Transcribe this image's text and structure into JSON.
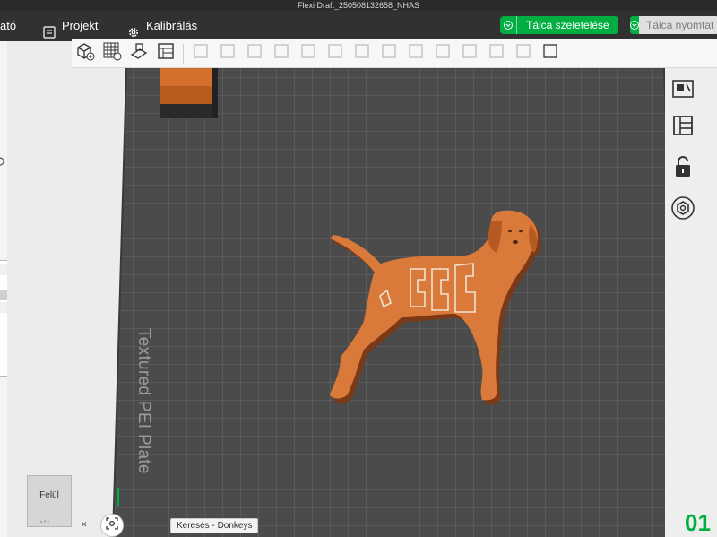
{
  "window": {
    "title": "Flexi Draft_250508132658_NHAS"
  },
  "menu": {
    "cut_item": "ató",
    "project": "Projekt",
    "calibration": "Kalibrálás"
  },
  "actions": {
    "slice_plate": "Tálca szeletelése",
    "print_plate": "Tálca nyomtat"
  },
  "toolbar": {
    "icons": [
      "add-cube-icon",
      "grid-arrange-icon",
      "auto-orient-icon",
      "plate-layout-icon",
      "move-icon",
      "rotate-icon",
      "scale-icon",
      "cut-icon",
      "support-paint-icon",
      "seam-paint-icon",
      "color-paint-icon",
      "mesh-boolean-icon",
      "emboss-icon",
      "measure-icon",
      "assembly-icon",
      "split-icon",
      "close-icon",
      "settings-icon"
    ]
  },
  "right_panel": {
    "icons": [
      "auto-arrange-icon",
      "plate-layout-icon",
      "unlock-icon",
      "hex-nut-icon"
    ]
  },
  "viewport": {
    "plate_label": "Textured PEI Plate",
    "view_cube_label": "Felül",
    "search_tooltip": "Keresés - Donkeys",
    "plate_number": "01"
  },
  "colors": {
    "accent_green": "#00ae42",
    "bed_dark": "#4a4a4a",
    "bed_grid": "#606060",
    "model_orange": "#d97a3b",
    "model_shadow": "#7a3a17"
  }
}
